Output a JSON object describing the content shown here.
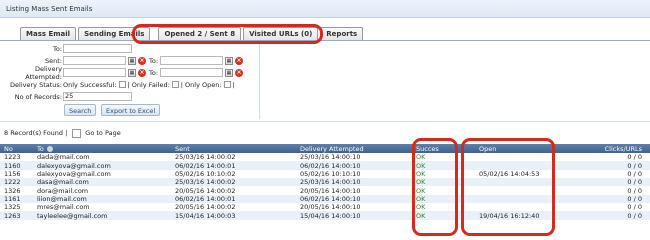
{
  "window": {
    "title": "Listing Mass Sent Emails"
  },
  "tabs": [
    {
      "label": "Mass Email"
    },
    {
      "label": "Sending Emails"
    },
    {
      "label": "Opened 2 / Sent 8"
    },
    {
      "label": "Visited URLs (0)"
    },
    {
      "label": "Reports"
    }
  ],
  "filters": {
    "to_label": "To:",
    "sent_label": "Sent:",
    "delivery_attempted_label": "Delivery Attempted:",
    "range_to": "To:",
    "delivery_status_label": "Delivery Status:",
    "only_successful": "Only Successful:",
    "only_failed": "| Only Failed:",
    "only_open": "| Only Open:",
    "trailing_bar": "|",
    "records_label": "No of Records:",
    "records_value": "25",
    "search_button": "Search",
    "export_button": "Export to Excel"
  },
  "summary": {
    "found": "8 Record(s) Found |",
    "goto": "Go to Page"
  },
  "table": {
    "headers": {
      "no": "No",
      "to": "To",
      "sent": "Sent",
      "delivery": "Delivery Attempted",
      "success": "Succes",
      "open": "Open",
      "clicks": "Clicks/URLs"
    },
    "rows": [
      {
        "no": "1223",
        "to": "dada@mail.com",
        "sent": "25/03/16 14:00:02",
        "delivery": "25/03/16 14:00:10",
        "success": "OK",
        "open": "",
        "clicks": "0 / 0"
      },
      {
        "no": "1160",
        "to": "dalexyova@gmail.com",
        "sent": "06/02/16 14:00:01",
        "delivery": "06/02/16 14:00:10",
        "success": "OK",
        "open": "",
        "clicks": "0 / 0"
      },
      {
        "no": "1156",
        "to": "dalexyova@gmail.com",
        "sent": "05/02/16 10:10:02",
        "delivery": "05/02/16 10:10:10",
        "success": "OK",
        "open": "05/02/16 14:04:53",
        "clicks": "0 / 0"
      },
      {
        "no": "1222",
        "to": "dasa@mail.com",
        "sent": "25/03/16 14:00:02",
        "delivery": "25/03/16 14:00:10",
        "success": "OK",
        "open": "",
        "clicks": "0 / 0"
      },
      {
        "no": "1326",
        "to": "dora@mail.com",
        "sent": "20/05/16 14:00:02",
        "delivery": "20/05/16 14:00:10",
        "success": "OK",
        "open": "",
        "clicks": "0 / 0"
      },
      {
        "no": "1161",
        "to": "liion@mail.com",
        "sent": "06/02/16 14:00:01",
        "delivery": "06/02/16 14:00:10",
        "success": "OK",
        "open": "",
        "clicks": "0 / 0"
      },
      {
        "no": "1325",
        "to": "mres@mail.com",
        "sent": "20/05/16 14:00:02",
        "delivery": "20/05/16 14:00:10",
        "success": "OK",
        "open": "",
        "clicks": "0 / 0"
      },
      {
        "no": "1263",
        "to": "tayleelee@gmail.com",
        "sent": "15/04/16 14:00:03",
        "delivery": "15/04/16 14:00:10",
        "success": "OK",
        "open": "19/04/16 16:12:40",
        "clicks": "0 / 0"
      }
    ]
  },
  "icons": {
    "calendar": "calendar-icon",
    "clear": "clear-icon",
    "sort": "sort-icon"
  },
  "colors": {
    "highlight": "#d32a1e",
    "header": "#4a6d97",
    "ok": "#2b8a1f",
    "row_alt": "#e9f0f8"
  }
}
